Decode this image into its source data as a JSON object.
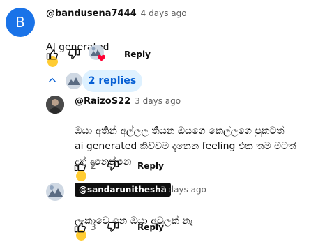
{
  "comment": {
    "avatar_letter": "B",
    "author": "@bandusena7444",
    "time": "4 days ago",
    "text": "AI generated",
    "emoji": "😂",
    "reply_label": "Reply",
    "replies_label": "2 replies",
    "creator_heart_icon": "heart-icon"
  },
  "replies": [
    {
      "author": "@RaizoS22",
      "time": "3 days ago",
      "text": "ඔයා අතින් අල්ලල තියන ඔයගෙ  කෙල්ලගෙ පුකටත්\nai generated කිව්වම දැනෙන feeling එක තම මටත්\nදැන් දැනෙන්නෙ",
      "emojis": "😂 😂",
      "likes": "2",
      "reply_label": "Reply"
    },
    {
      "mention": "@sandarunithesha",
      "time": "3 days ago",
      "text": "ලංකාවෙ නෙ ඔයා අවුලක් නෑ",
      "emoji": "😂",
      "likes": "3",
      "reply_label": "Reply"
    }
  ],
  "colors": {
    "avatar_blue": "#1a73e8",
    "link_blue": "#065fd4",
    "pill_bg": "#def1ff",
    "heart_red": "#ff0033"
  }
}
